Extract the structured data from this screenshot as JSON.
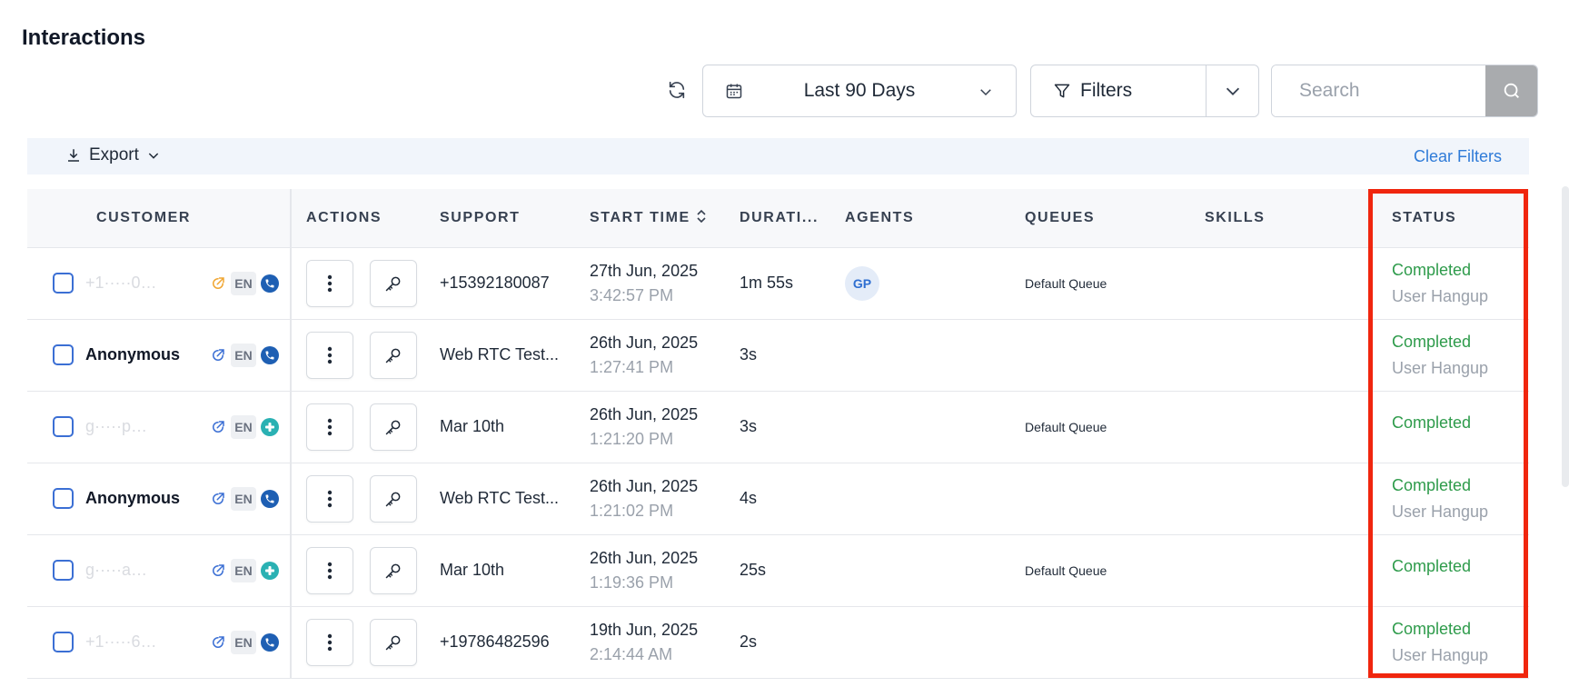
{
  "page": {
    "title": "Interactions"
  },
  "toolbar": {
    "date_range": "Last 90 Days",
    "filters_label": "Filters",
    "search_placeholder": "Search"
  },
  "export_bar": {
    "export_label": "Export",
    "clear_filters": "Clear Filters"
  },
  "table": {
    "headers": {
      "customer": "CUSTOMER",
      "actions": "ACTIONS",
      "support": "SUPPORT",
      "start_time": "START TIME",
      "duration": "DURATI...",
      "agents": "AGENTS",
      "queues": "QUEUES",
      "skills": "SKILLS",
      "status": "STATUS"
    },
    "rows": [
      {
        "customer": "+1·····0…",
        "lang": "EN",
        "support": "+15392180087",
        "date": "27th Jun, 2025",
        "time": "3:42:57 PM",
        "duration": "1m 55s",
        "agent": "GP",
        "queue": "Default Queue",
        "status": "Completed",
        "reason": "User Hangup"
      },
      {
        "customer": "Anonymous",
        "lang": "EN",
        "support": "Web RTC Test...",
        "date": "26th Jun, 2025",
        "time": "1:27:41 PM",
        "duration": "3s",
        "agent": "",
        "queue": "",
        "status": "Completed",
        "reason": "User Hangup"
      },
      {
        "customer": "g·····p…",
        "lang": "EN",
        "support": "Mar 10th",
        "date": "26th Jun, 2025",
        "time": "1:21:20 PM",
        "duration": "3s",
        "agent": "",
        "queue": "Default Queue",
        "status": "Completed",
        "reason": ""
      },
      {
        "customer": "Anonymous",
        "lang": "EN",
        "support": "Web RTC Test...",
        "date": "26th Jun, 2025",
        "time": "1:21:02 PM",
        "duration": "4s",
        "agent": "",
        "queue": "",
        "status": "Completed",
        "reason": "User Hangup"
      },
      {
        "customer": "g·····a…",
        "lang": "EN",
        "support": "Mar 10th",
        "date": "26th Jun, 2025",
        "time": "1:19:36 PM",
        "duration": "25s",
        "agent": "",
        "queue": "Default Queue",
        "status": "Completed",
        "reason": ""
      },
      {
        "customer": "+1·····6…",
        "lang": "EN",
        "support": "+19786482596",
        "date": "19th Jun, 2025",
        "time": "2:14:44 AM",
        "duration": "2s",
        "agent": "",
        "queue": "",
        "status": "Completed",
        "reason": "User Hangup"
      }
    ]
  }
}
